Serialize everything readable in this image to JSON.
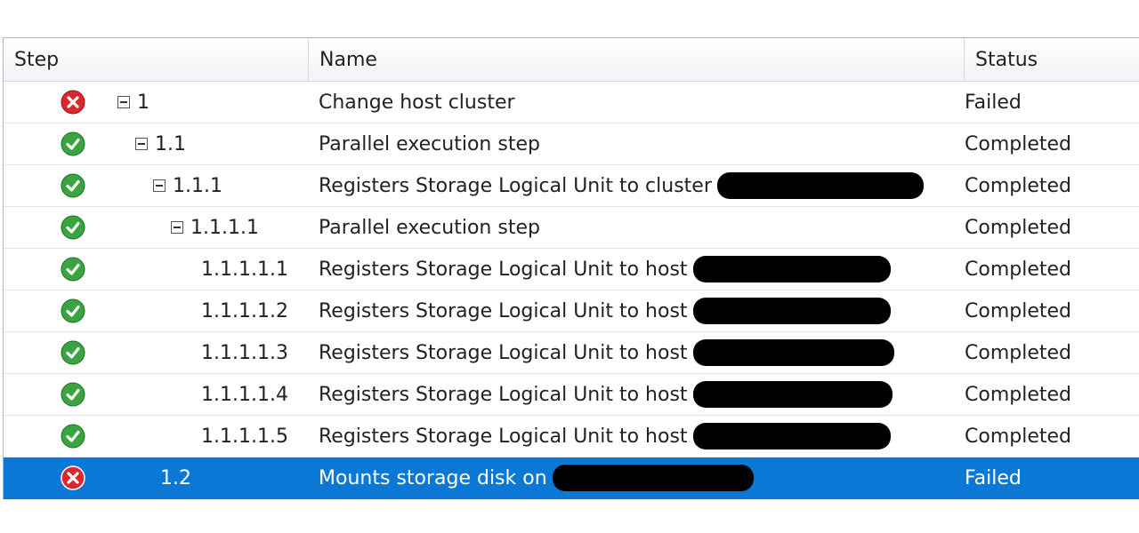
{
  "columns": {
    "step": "Step",
    "name": "Name",
    "status": "Status"
  },
  "colors": {
    "failed": "#d9292f",
    "completed": "#3aa441",
    "selected": "#0c78d6"
  },
  "rows": [
    {
      "step": "1",
      "name": "Change host cluster",
      "status": "Failed",
      "icon": "error-icon"
    },
    {
      "step": "1.1",
      "name": "Parallel execution step",
      "status": "Completed",
      "icon": "check-icon"
    },
    {
      "step": "1.1.1",
      "name": "Registers Storage Logical Unit to cluster",
      "status": "Completed",
      "icon": "check-icon"
    },
    {
      "step": "1.1.1.1",
      "name": "Parallel execution step",
      "status": "Completed",
      "icon": "check-icon"
    },
    {
      "step": "1.1.1.1.1",
      "name": "Registers Storage Logical Unit to host",
      "status": "Completed",
      "icon": "check-icon"
    },
    {
      "step": "1.1.1.1.2",
      "name": "Registers Storage Logical Unit to host",
      "status": "Completed",
      "icon": "check-icon"
    },
    {
      "step": "1.1.1.1.3",
      "name": "Registers Storage Logical Unit to host",
      "status": "Completed",
      "icon": "check-icon"
    },
    {
      "step": "1.1.1.1.4",
      "name": "Registers Storage Logical Unit to host",
      "status": "Completed",
      "icon": "check-icon"
    },
    {
      "step": "1.1.1.1.5",
      "name": "Registers Storage Logical Unit to host",
      "status": "Completed",
      "icon": "check-icon"
    },
    {
      "step": "1.2",
      "name": "Mounts storage disk on",
      "status": "Failed",
      "icon": "error-icon"
    }
  ]
}
